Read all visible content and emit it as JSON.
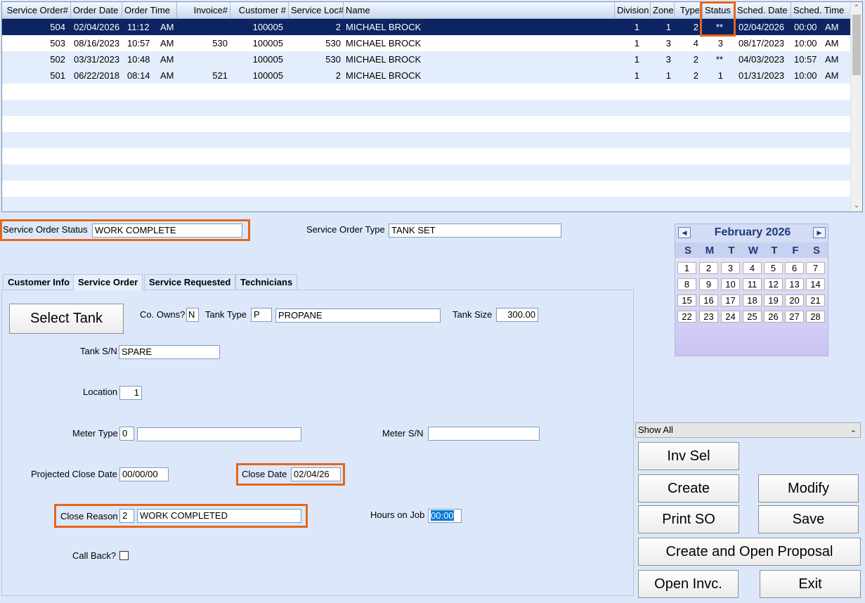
{
  "grid": {
    "headers": [
      "Service Order#",
      "Order Date",
      "Order Time",
      "Invoice#",
      "Customer #",
      "Service Loc#",
      "Name",
      "Division",
      "Zone",
      "Type",
      "Status",
      "Sched. Date",
      "Sched. Time"
    ],
    "rows": [
      {
        "so": "504",
        "date": "02/04/2026",
        "time": "11:12",
        "ampm": "AM",
        "invoice": "",
        "customer": "100005",
        "loc": "2",
        "name": "MICHAEL BROCK",
        "division": "1",
        "zone": "1",
        "type": "2",
        "status": "**",
        "sched_date": "02/04/2026",
        "sched_time": "00:00",
        "sched_ampm": "AM"
      },
      {
        "so": "503",
        "date": "08/16/2023",
        "time": "10:57",
        "ampm": "AM",
        "invoice": "530",
        "customer": "100005",
        "loc": "530",
        "name": "MICHAEL BROCK",
        "division": "1",
        "zone": "3",
        "type": "4",
        "status": "3",
        "sched_date": "08/17/2023",
        "sched_time": "10:00",
        "sched_ampm": "AM"
      },
      {
        "so": "502",
        "date": "03/31/2023",
        "time": "10:48",
        "ampm": "AM",
        "invoice": "",
        "customer": "100005",
        "loc": "530",
        "name": "MICHAEL BROCK",
        "division": "1",
        "zone": "3",
        "type": "2",
        "status": "**",
        "sched_date": "04/03/2023",
        "sched_time": "10:57",
        "sched_ampm": "AM"
      },
      {
        "so": "501",
        "date": "06/22/2018",
        "time": "08:14",
        "ampm": "AM",
        "invoice": "521",
        "customer": "100005",
        "loc": "2",
        "name": "MICHAEL BROCK",
        "division": "1",
        "zone": "1",
        "type": "2",
        "status": "1",
        "sched_date": "01/31/2023",
        "sched_time": "10:00",
        "sched_ampm": "AM"
      }
    ]
  },
  "form": {
    "status_label": "Service Order Status",
    "status_value": "WORK COMPLETE",
    "type_label": "Service Order Type",
    "type_value": "TANK SET"
  },
  "tabs": [
    "Customer Info",
    "Service Order",
    "Service Requested",
    "Technicians"
  ],
  "service_order": {
    "select_tank": "Select Tank",
    "co_owns_label": "Co. Owns?",
    "co_owns_value": "N",
    "tank_type_label": "Tank Type",
    "tank_type_code": "P",
    "tank_type_name": "PROPANE",
    "tank_size_label": "Tank Size",
    "tank_size_value": "300.00",
    "tank_sn_label": "Tank S/N",
    "tank_sn_value": "SPARE",
    "location_label": "Location",
    "location_value": "1",
    "meter_type_label": "Meter Type",
    "meter_type_code": "0",
    "meter_type_name": "",
    "meter_sn_label": "Meter S/N",
    "meter_sn_value": "",
    "projected_close_label": "Projected Close Date",
    "projected_close_value": "00/00/00",
    "close_date_label": "Close Date",
    "close_date_value": "02/04/26",
    "close_reason_label": "Close Reason",
    "close_reason_code": "2",
    "close_reason_name": "WORK COMPLETED",
    "hours_label": "Hours on Job",
    "hours_value": "00:00",
    "call_back_label": "Call Back?"
  },
  "calendar": {
    "month": "February 2026",
    "prev_icon": "◀",
    "next_icon": "▶",
    "dows": [
      "S",
      "M",
      "T",
      "W",
      "T",
      "F",
      "S"
    ],
    "days": [
      "1",
      "2",
      "3",
      "4",
      "5",
      "6",
      "7",
      "8",
      "9",
      "10",
      "11",
      "12",
      "13",
      "14",
      "15",
      "16",
      "17",
      "18",
      "19",
      "20",
      "21",
      "22",
      "23",
      "24",
      "25",
      "26",
      "27",
      "28"
    ]
  },
  "filter": {
    "selected": "Show All"
  },
  "buttons": {
    "inv_sel": "Inv Sel",
    "create": "Create",
    "modify": "Modify",
    "print_so": "Print SO",
    "save": "Save",
    "create_open_proposal": "Create and Open Proposal",
    "open_invc": "Open Invc.",
    "exit": "Exit"
  },
  "colors": {
    "highlight": "#e4661b",
    "selected_row": "#0c2461",
    "background": "#dce8fa"
  }
}
